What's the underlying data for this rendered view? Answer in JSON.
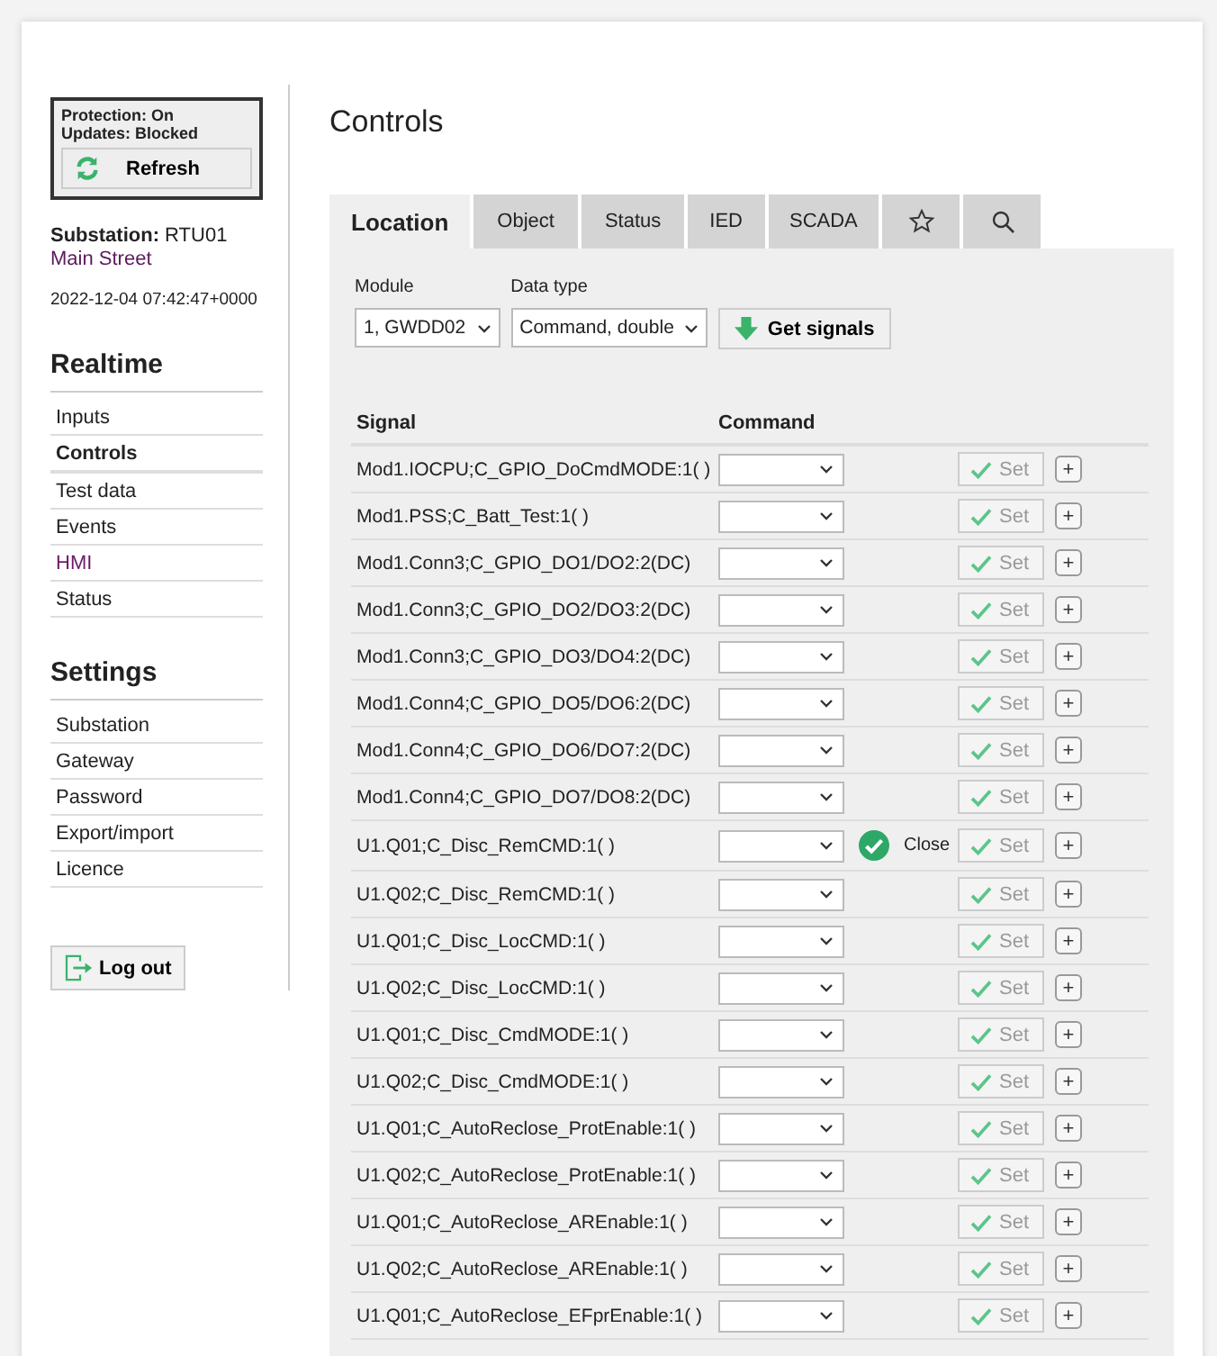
{
  "status_box": {
    "lines": [
      "Protection: On",
      "Updates: Blocked"
    ],
    "refresh_label": "Refresh"
  },
  "substation": {
    "label": "Substation:",
    "name": "RTU01",
    "address": "Main Street",
    "timestamp": "2022-12-04 07:42:47+0000"
  },
  "nav": [
    {
      "title": "Realtime",
      "items": [
        {
          "label": "Inputs",
          "selected": false,
          "visited": false
        },
        {
          "label": "Controls",
          "selected": true,
          "visited": false
        },
        {
          "label": "Test data",
          "selected": false,
          "visited": false
        },
        {
          "label": "Events",
          "selected": false,
          "visited": false
        },
        {
          "label": "HMI",
          "selected": false,
          "visited": true
        },
        {
          "label": "Status",
          "selected": false,
          "visited": false
        }
      ]
    },
    {
      "title": "Settings",
      "items": [
        {
          "label": "Substation",
          "selected": false,
          "visited": false
        },
        {
          "label": "Gateway",
          "selected": false,
          "visited": false
        },
        {
          "label": "Password",
          "selected": false,
          "visited": false
        },
        {
          "label": "Export/import",
          "selected": false,
          "visited": false
        },
        {
          "label": "Licence",
          "selected": false,
          "visited": false
        }
      ]
    }
  ],
  "logout_label": "Log out",
  "page_title": "Controls",
  "tabs": [
    {
      "kind": "text",
      "label": "Location",
      "selected": true
    },
    {
      "kind": "text",
      "label": "Object",
      "selected": false
    },
    {
      "kind": "text",
      "label": "Status",
      "selected": false
    },
    {
      "kind": "text",
      "label": "IED",
      "selected": false
    },
    {
      "kind": "text",
      "label": "SCADA",
      "selected": false
    },
    {
      "kind": "star",
      "selected": false
    },
    {
      "kind": "search",
      "selected": false
    }
  ],
  "filters": [
    {
      "label": "Module",
      "value": "1, GWDD02"
    },
    {
      "label": "Data type",
      "value": "Command, double"
    }
  ],
  "get_signals_label": "Get signals",
  "table": {
    "columns": [
      "Signal",
      "Command"
    ],
    "rows": [
      {
        "signal": "Mod1.IOCPU;C_GPIO_DoCmdMODE:1( )",
        "set": "Set",
        "add": "+"
      },
      {
        "signal": "Mod1.PSS;C_Batt_Test:1( )",
        "set": "Set",
        "add": "+"
      },
      {
        "signal": "Mod1.Conn3;C_GPIO_DO1/DO2:2(DC)",
        "set": "Set",
        "add": "+"
      },
      {
        "signal": "Mod1.Conn3;C_GPIO_DO2/DO3:2(DC)",
        "set": "Set",
        "add": "+"
      },
      {
        "signal": "Mod1.Conn3;C_GPIO_DO3/DO4:2(DC)",
        "set": "Set",
        "add": "+"
      },
      {
        "signal": "Mod1.Conn4;C_GPIO_DO5/DO6:2(DC)",
        "set": "Set",
        "add": "+"
      },
      {
        "signal": "Mod1.Conn4;C_GPIO_DO6/DO7:2(DC)",
        "set": "Set",
        "add": "+"
      },
      {
        "signal": "Mod1.Conn4;C_GPIO_DO7/DO8:2(DC)",
        "set": "Set",
        "add": "+"
      },
      {
        "signal": "U1.Q01;C_Disc_RemCMD:1( )",
        "status": "Close",
        "set": "Set",
        "add": "+"
      },
      {
        "signal": "U1.Q02;C_Disc_RemCMD:1( )",
        "set": "Set",
        "add": "+"
      },
      {
        "signal": "U1.Q01;C_Disc_LocCMD:1( )",
        "set": "Set",
        "add": "+"
      },
      {
        "signal": "U1.Q02;C_Disc_LocCMD:1( )",
        "set": "Set",
        "add": "+"
      },
      {
        "signal": "U1.Q01;C_Disc_CmdMODE:1( )",
        "set": "Set",
        "add": "+"
      },
      {
        "signal": "U1.Q02;C_Disc_CmdMODE:1( )",
        "set": "Set",
        "add": "+"
      },
      {
        "signal": "U1.Q01;C_AutoReclose_ProtEnable:1( )",
        "set": "Set",
        "add": "+"
      },
      {
        "signal": "U1.Q02;C_AutoReclose_ProtEnable:1( )",
        "set": "Set",
        "add": "+"
      },
      {
        "signal": "U1.Q01;C_AutoReclose_AREnable:1( )",
        "set": "Set",
        "add": "+"
      },
      {
        "signal": "U1.Q02;C_AutoReclose_AREnable:1( )",
        "set": "Set",
        "add": "+"
      },
      {
        "signal": "U1.Q01;C_AutoReclose_EFprEnable:1( )",
        "set": "Set",
        "add": "+"
      }
    ]
  }
}
